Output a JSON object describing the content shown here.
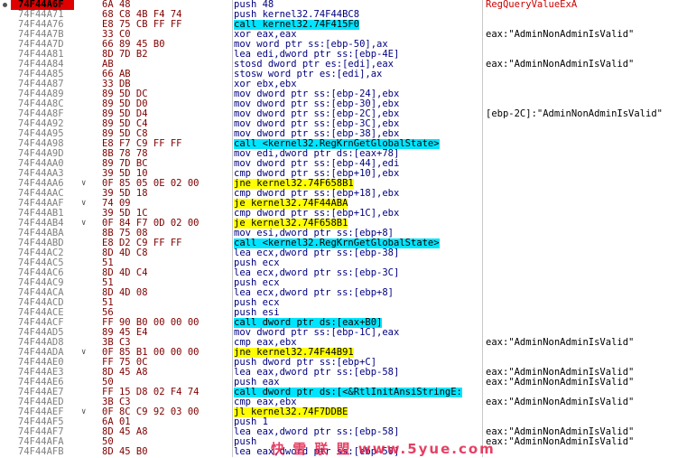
{
  "rows": [
    {
      "addr": "74F44A6F",
      "mark": "",
      "bytes": "6A 48",
      "ins": "push 48",
      "ins_hl": "",
      "cmt": "RegQueryValueExA",
      "cmt_api": true,
      "bp": true
    },
    {
      "addr": "74F44A71",
      "mark": "",
      "bytes": "68 C8 4B F4 74",
      "ins": "push kernel32.74F44BC8",
      "ins_hl": "",
      "cmt": ""
    },
    {
      "addr": "74F44A76",
      "mark": "",
      "bytes": "E8 75 CB FF FF",
      "ins": "call kernel32.74F415F0",
      "ins_hl": "call",
      "cmt": ""
    },
    {
      "addr": "74F44A7B",
      "mark": "",
      "bytes": "33 C0",
      "ins": "xor eax,eax",
      "ins_hl": "",
      "cmt": "eax:\"AdminNonAdminIsValid\""
    },
    {
      "addr": "74F44A7D",
      "mark": "",
      "bytes": "66 89 45 B0",
      "ins": "mov word ptr ss:[ebp-50],ax",
      "ins_hl": "",
      "cmt": ""
    },
    {
      "addr": "74F44A81",
      "mark": "",
      "bytes": "8D 7D B2",
      "ins": "lea edi,dword ptr ss:[ebp-4E]",
      "ins_hl": "",
      "cmt": ""
    },
    {
      "addr": "74F44A84",
      "mark": "",
      "bytes": "AB",
      "ins": "stosd dword ptr es:[edi],eax",
      "ins_hl": "",
      "cmt": "eax:\"AdminNonAdminIsValid\""
    },
    {
      "addr": "74F44A85",
      "mark": "",
      "bytes": "66 AB",
      "ins": "stosw word ptr es:[edi],ax",
      "ins_hl": "",
      "cmt": ""
    },
    {
      "addr": "74F44A87",
      "mark": "",
      "bytes": "33 DB",
      "ins": "xor ebx,ebx",
      "ins_hl": "",
      "cmt": ""
    },
    {
      "addr": "74F44A89",
      "mark": "",
      "bytes": "89 5D DC",
      "ins": "mov dword ptr ss:[ebp-24],ebx",
      "ins_hl": "",
      "cmt": ""
    },
    {
      "addr": "74F44A8C",
      "mark": "",
      "bytes": "89 5D D0",
      "ins": "mov dword ptr ss:[ebp-30],ebx",
      "ins_hl": "",
      "cmt": ""
    },
    {
      "addr": "74F44A8F",
      "mark": "",
      "bytes": "89 5D D4",
      "ins": "mov dword ptr ss:[ebp-2C],ebx",
      "ins_hl": "",
      "cmt": "[ebp-2C]:\"AdminNonAdminIsValid\""
    },
    {
      "addr": "74F44A92",
      "mark": "",
      "bytes": "89 5D C4",
      "ins": "mov dword ptr ss:[ebp-3C],ebx",
      "ins_hl": "",
      "cmt": ""
    },
    {
      "addr": "74F44A95",
      "mark": "",
      "bytes": "89 5D C8",
      "ins": "mov dword ptr ss:[ebp-38],ebx",
      "ins_hl": "",
      "cmt": ""
    },
    {
      "addr": "74F44A98",
      "mark": "",
      "bytes": "E8 F7 C9 FF FF",
      "ins": "call <kernel32.RegKrnGetGlobalState>",
      "ins_hl": "call",
      "cmt": ""
    },
    {
      "addr": "74F44A9D",
      "mark": "",
      "bytes": "8B 78 78",
      "ins": "mov edi,dword ptr ds:[eax+78]",
      "ins_hl": "",
      "cmt": ""
    },
    {
      "addr": "74F44AA0",
      "mark": "",
      "bytes": "89 7D BC",
      "ins": "mov dword ptr ss:[ebp-44],edi",
      "ins_hl": "",
      "cmt": ""
    },
    {
      "addr": "74F44AA3",
      "mark": "",
      "bytes": "39 5D 10",
      "ins": "cmp dword ptr ss:[ebp+10],ebx",
      "ins_hl": "",
      "cmt": ""
    },
    {
      "addr": "74F44AA6",
      "mark": "∨",
      "bytes": "0F 85 05 0E 02 00",
      "ins": "jne kernel32.74F658B1",
      "ins_hl": "jmp",
      "cmt": ""
    },
    {
      "addr": "74F44AAC",
      "mark": "",
      "bytes": "39 5D 18",
      "ins": "cmp dword ptr ss:[ebp+18],ebx",
      "ins_hl": "",
      "cmt": ""
    },
    {
      "addr": "74F44AAF",
      "mark": "∨",
      "bytes": "74 09",
      "ins": "je kernel32.74F44ABA",
      "ins_hl": "jmp",
      "cmt": ""
    },
    {
      "addr": "74F44AB1",
      "mark": "",
      "bytes": "39 5D 1C",
      "ins": "cmp dword ptr ss:[ebp+1C],ebx",
      "ins_hl": "",
      "cmt": ""
    },
    {
      "addr": "74F44AB4",
      "mark": "∨",
      "bytes": "0F 84 F7 0D 02 00",
      "ins": "je kernel32.74F658B1",
      "ins_hl": "jmp",
      "cmt": ""
    },
    {
      "addr": "74F44ABA",
      "mark": "",
      "bytes": "8B 75 08",
      "ins": "mov esi,dword ptr ss:[ebp+8]",
      "ins_hl": "",
      "cmt": ""
    },
    {
      "addr": "74F44ABD",
      "mark": "",
      "bytes": "E8 D2 C9 FF FF",
      "ins": "call <kernel32.RegKrnGetGlobalState>",
      "ins_hl": "call",
      "cmt": ""
    },
    {
      "addr": "74F44AC2",
      "mark": "",
      "bytes": "8D 4D C8",
      "ins": "lea ecx,dword ptr ss:[ebp-38]",
      "ins_hl": "",
      "cmt": ""
    },
    {
      "addr": "74F44AC5",
      "mark": "",
      "bytes": "51",
      "ins": "push ecx",
      "ins_hl": "",
      "cmt": ""
    },
    {
      "addr": "74F44AC6",
      "mark": "",
      "bytes": "8D 4D C4",
      "ins": "lea ecx,dword ptr ss:[ebp-3C]",
      "ins_hl": "",
      "cmt": ""
    },
    {
      "addr": "74F44AC9",
      "mark": "",
      "bytes": "51",
      "ins": "push ecx",
      "ins_hl": "",
      "cmt": ""
    },
    {
      "addr": "74F44ACA",
      "mark": "",
      "bytes": "8D 4D 08",
      "ins": "lea ecx,dword ptr ss:[ebp+8]",
      "ins_hl": "",
      "cmt": ""
    },
    {
      "addr": "74F44ACD",
      "mark": "",
      "bytes": "51",
      "ins": "push ecx",
      "ins_hl": "",
      "cmt": ""
    },
    {
      "addr": "74F44ACE",
      "mark": "",
      "bytes": "56",
      "ins": "push esi",
      "ins_hl": "",
      "cmt": ""
    },
    {
      "addr": "74F44ACF",
      "mark": "",
      "bytes": "FF 90 B0 00 00 00",
      "ins": "call dword ptr ds:[eax+B0]",
      "ins_hl": "call",
      "cmt": ""
    },
    {
      "addr": "74F44AD5",
      "mark": "",
      "bytes": "89 45 E4",
      "ins": "mov dword ptr ss:[ebp-1C],eax",
      "ins_hl": "",
      "cmt": ""
    },
    {
      "addr": "74F44AD8",
      "mark": "",
      "bytes": "3B C3",
      "ins": "cmp eax,ebx",
      "ins_hl": "",
      "cmt": "eax:\"AdminNonAdminIsValid\""
    },
    {
      "addr": "74F44ADA",
      "mark": "∨",
      "bytes": "0F 85 B1 00 00 00",
      "ins": "jne kernel32.74F44B91",
      "ins_hl": "jmp",
      "cmt": ""
    },
    {
      "addr": "74F44AE0",
      "mark": "",
      "bytes": "FF 75 0C",
      "ins": "push dword ptr ss:[ebp+C]",
      "ins_hl": "",
      "cmt": ""
    },
    {
      "addr": "74F44AE3",
      "mark": "",
      "bytes": "8D 45 A8",
      "ins": "lea eax,dword ptr ss:[ebp-58]",
      "ins_hl": "",
      "cmt": "eax:\"AdminNonAdminIsValid\""
    },
    {
      "addr": "74F44AE6",
      "mark": "",
      "bytes": "50",
      "ins": "push eax",
      "ins_hl": "",
      "cmt": "eax:\"AdminNonAdminIsValid\""
    },
    {
      "addr": "74F44AE7",
      "mark": "",
      "bytes": "FF 15 D8 02 F4 74",
      "ins": "call dword ptr ds:[<&RtlInitAnsiStringE:",
      "ins_hl": "call",
      "cmt": ""
    },
    {
      "addr": "74F44AED",
      "mark": "",
      "bytes": "3B C3",
      "ins": "cmp eax,ebx",
      "ins_hl": "",
      "cmt": "eax:\"AdminNonAdminIsValid\""
    },
    {
      "addr": "74F44AEF",
      "mark": "∨",
      "bytes": "0F 8C C9 92 03 00",
      "ins": "jl kernel32.74F7DDBE",
      "ins_hl": "jmp",
      "cmt": ""
    },
    {
      "addr": "74F44AF5",
      "mark": "",
      "bytes": "6A 01",
      "ins": "push 1",
      "ins_hl": "",
      "cmt": ""
    },
    {
      "addr": "74F44AF7",
      "mark": "",
      "bytes": "8D 45 A8",
      "ins": "lea eax,dword ptr ss:[ebp-58]",
      "ins_hl": "",
      "cmt": "eax:\"AdminNonAdminIsValid\""
    },
    {
      "addr": "74F44AFA",
      "mark": "",
      "bytes": "50",
      "ins": "push",
      "ins_hl": "",
      "cmt": "eax:\"AdminNonAdminIsValid\""
    },
    {
      "addr": "74F44AFB",
      "mark": "",
      "bytes": "8D 45 B0",
      "ins": "lea eax,dword ptr ss:[ebp-50]",
      "ins_hl": "",
      "cmt": ""
    }
  ],
  "watermark": "快 雪 联 盟   www.5yue.com",
  "colors": {
    "call": "#00e5ff",
    "jump": "#ffff00",
    "address_current": "#e00000",
    "bytes": "#800000",
    "code": "#000080"
  }
}
